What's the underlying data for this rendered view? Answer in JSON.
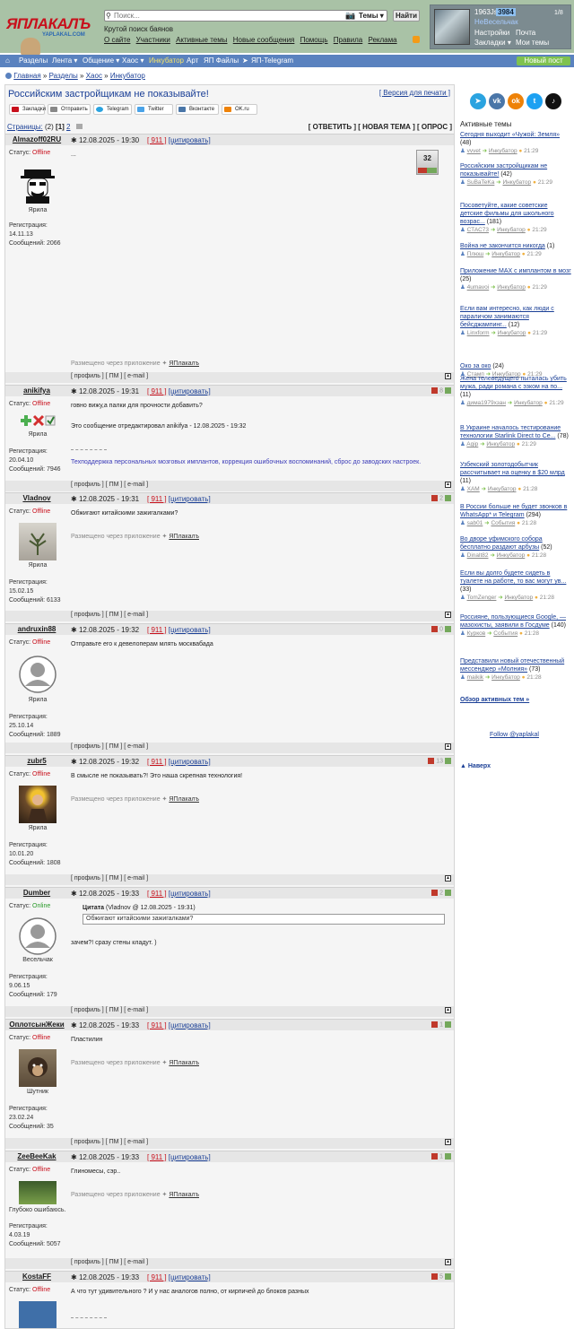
{
  "logo": {
    "text": "ЯПЛАКАЛЪ",
    "sub": "YAPLAKAL.COM"
  },
  "search": {
    "placeholder": "Поиск...",
    "scope": "Темы ▾",
    "button": "Найти",
    "caption": "Крутой поиск баянов"
  },
  "topnav": [
    "О сайте",
    "Участники",
    "Активные темы",
    "Новые сообщения",
    "Помощь",
    "Правила",
    "Реклама"
  ],
  "user": {
    "name": "1963Js",
    "count": "3984",
    "rank": "НеВесельчак",
    "menu": [
      "Настройки",
      "Почта",
      "Закладки ▾",
      "Мои темы"
    ],
    "extra": "1/8"
  },
  "mainnav": [
    "Разделы",
    "Лента ▾",
    "Общение ▾",
    "Хаос ▾",
    "Инкубатор",
    "Арт",
    "ЯП Файлы",
    "ЯП-Telegram"
  ],
  "newpost": "Новый пост",
  "breadcrumb": [
    "Главная",
    "Разделы",
    "Хаос",
    "Инкубатор"
  ],
  "topic": {
    "title": "Российским застройщикам не показывайте!",
    "print": "Версия для печати"
  },
  "share": [
    "Закладки",
    "Отправить",
    "Telegram",
    "Twitter",
    "Вконтакте",
    "OK.ru"
  ],
  "pages": {
    "label": "Страницы:",
    "current": "(2)",
    "p1": "[1]",
    "p2": "2"
  },
  "actions": "[ ОТВЕТИТЬ ] [ НОВАЯ ТЕМА ] [ ОПРОС ]",
  "post_labels": {
    "status": "Статус:",
    "registration": "Регистрация:",
    "messages_prefix": "Сообщений: ",
    "via": "Размещено через приложение",
    "app": "ЯПлакалъ",
    "footer": "[ профиль ] [ ПМ ] [ e-mail ]",
    "quote": "[цитировать]"
  },
  "posts": [
    {
      "author": "Almazoff02RU",
      "date": "12.08.2025 - 19:30",
      "num": "[ 911 ]",
      "status": "Offline",
      "rank": "Ярила",
      "reg": "14.11.13",
      "msgs": "2066",
      "text": "...",
      "rating": "32"
    },
    {
      "author": "anikifya",
      "date": "12.08.2025 - 19:31",
      "num": "[ 911 ]",
      "status": "Offline",
      "rank": "Ярила",
      "reg": "20.04.10",
      "msgs": "7946",
      "text": "говно вижу,а палки для прочности добавить?",
      "edit": "Это сообщение отредактировал anikifya - 12.08.2025 - 19:32",
      "sig": "Техподдержка персональных мозговых имплантов, коррекция ошибочных воспоминаний, сброс до заводских настроек.",
      "rating": "8"
    },
    {
      "author": "Vladnov",
      "date": "12.08.2025 - 19:31",
      "num": "[ 911 ]",
      "status": "Offline",
      "rank": "Ярила",
      "reg": "15.02.15",
      "msgs": "6133",
      "text": "Обжигают китайскими зажигалками?",
      "rating": "2"
    },
    {
      "author": "andruxin88",
      "date": "12.08.2025 - 19:32",
      "num": "[ 911 ]",
      "status": "Offline",
      "rank": "Ярила",
      "reg": "25.10.14",
      "msgs": "1889",
      "text": "Отправьте его к девелоперам млять москвабада",
      "rating": "0"
    },
    {
      "author": "zubr5",
      "date": "12.08.2025 - 19:32",
      "num": "[ 911 ]",
      "status": "Offline",
      "rank": "Ярила",
      "reg": "10.01.20",
      "msgs": "1808",
      "text": "В смысле не показывать?! Это наша скрепная технология!",
      "rating": "13"
    },
    {
      "author": "Dumber",
      "date": "12.08.2025 - 19:33",
      "num": "[ 911 ]",
      "status": "Online",
      "rank": "Весельчак",
      "reg": "9.06.15",
      "msgs": "179",
      "quote_head": "Цитата",
      "quote_src": "(Vladnov @ 12.08.2025 - 19:31)",
      "quote_text": "Обжигают китайскими зажигалками?",
      "text": "зачем?! сразу стены кладут. )",
      "rating": "2"
    },
    {
      "author": "ОплотсынЖеки",
      "date": "12.08.2025 - 19:33",
      "num": "[ 911 ]",
      "status": "Offline",
      "rank": "Шутник",
      "reg": "23.02.24",
      "msgs": "35",
      "text": "Пластилин",
      "rating": "1"
    },
    {
      "author": "ZeeBeeKak",
      "date": "12.08.2025 - 19:33",
      "num": "[ 911 ]",
      "status": "Offline",
      "rank": "Глубоко ошибаюсь.",
      "reg": "4.03.19",
      "msgs": "5057",
      "text": "Глиномесы, сэр..",
      "rating": "1"
    },
    {
      "author": "KostaFF",
      "date": "12.08.2025 - 19:33",
      "num": "[ 911 ]",
      "status": "Offline",
      "text": "А что тут удивительного ? И у нас аналогов полно, от кирпичей до блоков разных",
      "rating": "5"
    }
  ],
  "sidebar": {
    "title": "Активные темы",
    "topics": [
      {
        "title": "Сегодня выходит «Чужой: Земля»",
        "count": "(48)",
        "user": "vvvet",
        "sec": "Инкубатор",
        "time": "21:29"
      },
      {
        "title": "Российским застройщикам не показывайте!",
        "count": "(42)",
        "user": "SuBaTeKa",
        "sec": "Инкубатор",
        "time": "21:29"
      },
      {
        "title": "Посоветуйте, какие советские детские фильмы для школьного возрас...",
        "count": "(181)",
        "user": "СТАС73",
        "sec": "Инкубатор",
        "time": "21:29"
      },
      {
        "title": "Война не закончится никогда",
        "count": "(1)",
        "user": "Плюш",
        "sec": "Инкубатор",
        "time": "21:29"
      },
      {
        "title": "Приложение MAX с имплантом в мозг",
        "count": "(25)",
        "user": "4umavoi",
        "sec": "Инкубатор",
        "time": "21:29"
      },
      {
        "title": "Если вам интересно, как люди с параличом занимаются бейсджампинг...",
        "count": "(12)",
        "user": "Linxform",
        "sec": "Инкубатор",
        "time": "21:29"
      },
      {
        "title": "Око за око",
        "count": "(24)",
        "user": "Стамп",
        "sec": "Инкубатор",
        "time": "21:29"
      },
      {
        "title": "Жена телеведущего пыталась убить мужа, ради романа с эзком на по...",
        "count": "(11)",
        "user": "дима1979хзан",
        "sec": "Инкубатор",
        "time": "21:29"
      },
      {
        "title": "В Украине началось тестирование технологии Starlink Direct to Ce...",
        "count": "(78)",
        "user": "Agip",
        "sec": "Инкубатор",
        "time": "21:29"
      },
      {
        "title": "Узбекский золотодобытчик рассчитывает на оценку в $20 млрд",
        "count": "(11)",
        "user": "ХАМ",
        "sec": "Инкубатор",
        "time": "21:28"
      },
      {
        "title": "В России больше не будет звонков в WhatsApp* и Telegram",
        "count": "(294)",
        "user": "sab01",
        "sec": "События",
        "time": "21:28"
      },
      {
        "title": "Во дворе уфимского собора бесплатно раздают арбузы",
        "count": "(52)",
        "user": "Dinalt82",
        "sec": "Инкубатор",
        "time": "21:28"
      },
      {
        "title": "Если вы долго будете сидеть в туалете на работе, то вас могут ув...",
        "count": "(33)",
        "user": "TomZenger",
        "sec": "Инкубатор",
        "time": "21:28"
      },
      {
        "title": "Россияне, пользующиеся Google, — мазохисты, заявили в Госдуме",
        "count": "(140)",
        "user": "Курков",
        "sec": "События",
        "time": "21:28"
      },
      {
        "title": "Представили новый отечественный мессенджер «Молния»",
        "count": "(73)",
        "user": "maikik",
        "sec": "Инкубатор",
        "time": "21:28"
      }
    ],
    "all": "Обзор активных тем »",
    "follow": "Follow @yaplakal",
    "tolast": "Наверх"
  }
}
